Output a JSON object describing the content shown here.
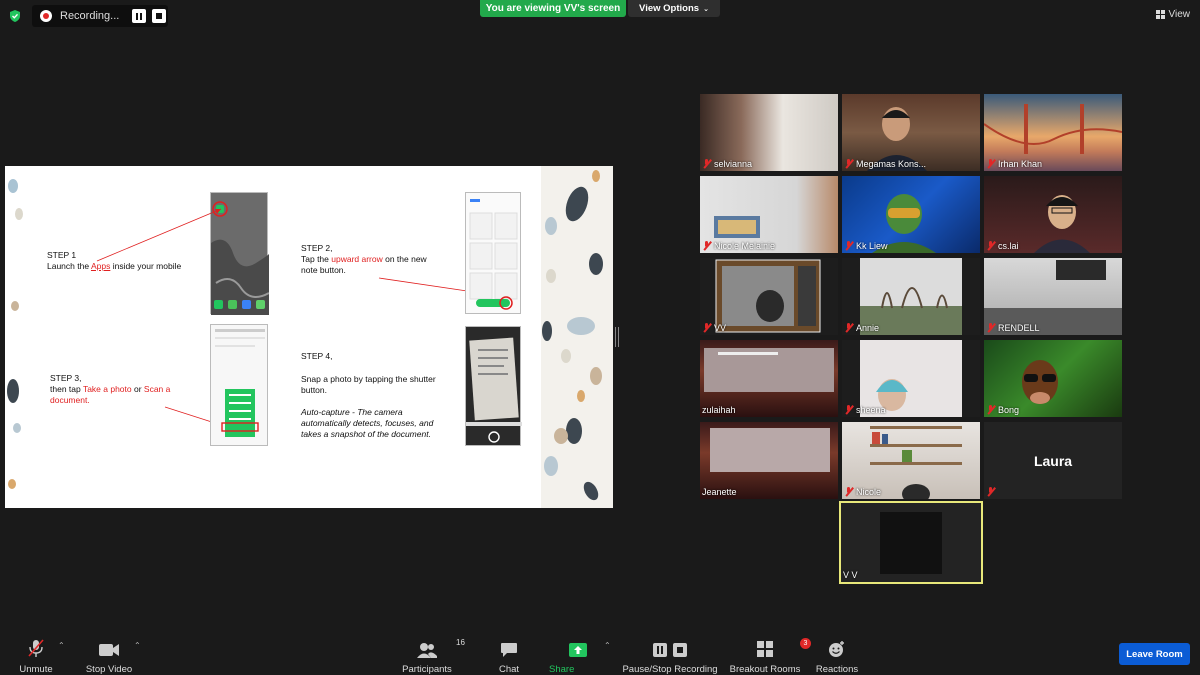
{
  "topbar": {
    "recording_label": "Recording...",
    "viewing_label": "You are viewing VV's screen",
    "view_options_label": "View Options",
    "view_label": "View"
  },
  "slide": {
    "step1_title": "STEP 1",
    "step1_pre": "Launch the ",
    "step1_link": "Apps",
    "step1_post": " inside your mobile",
    "step2_title": "STEP 2,",
    "step2_pre": "Tap the ",
    "step2_red": "upward arrow",
    "step2_post": " on the new",
    "step2_line2": "note button.",
    "step3_title": "STEP 3,",
    "step3_pre": "then tap ",
    "step3_red1": "Take a photo",
    "step3_mid": " or ",
    "step3_red2": "Scan a",
    "step3_red3": "document.",
    "step4_title": "STEP 4,",
    "step4_line1": "Snap a photo by tapping the shutter",
    "step4_line2": "button.",
    "step4_note1": "Auto-capture - The camera",
    "step4_note2": "automatically detects, focuses, and",
    "step4_note3": "takes a snapshot of the document."
  },
  "gallery": [
    {
      "name": "selvianna",
      "muted": true
    },
    {
      "name": "Megamas Kons...",
      "muted": true
    },
    {
      "name": "Irhan Khan",
      "muted": true
    },
    {
      "name": "Nicole Melainie",
      "muted": true
    },
    {
      "name": "Kk Liew",
      "muted": true
    },
    {
      "name": "cs.lai",
      "muted": true
    },
    {
      "name": "VV",
      "muted": true
    },
    {
      "name": "Annie",
      "muted": true
    },
    {
      "name": "RENDELL",
      "muted": true
    },
    {
      "name": "zulaihah",
      "muted": false
    },
    {
      "name": "sheena",
      "muted": true
    },
    {
      "name": "Bong",
      "muted": true
    },
    {
      "name": "Jeanette",
      "muted": false
    },
    {
      "name": "Nicole",
      "muted": true
    },
    {
      "name": "Laura",
      "muted": true
    },
    {
      "name": "V V",
      "muted": false
    }
  ],
  "toolbar": {
    "unmute": "Unmute",
    "stop_video": "Stop Video",
    "participants": "Participants",
    "participants_count": "16",
    "chat": "Chat",
    "share_screen": "Share Screen",
    "pause_stop_recording": "Pause/Stop Recording",
    "breakout_rooms": "Breakout Rooms",
    "breakout_badge": "3",
    "reactions": "Reactions",
    "leave_room": "Leave Room"
  },
  "colors": {
    "background": "#1a1a1a",
    "viewing_green": "#22a94b",
    "share_green": "#22c55e",
    "leave_blue": "#0b5cd5",
    "muted_red": "#e02828",
    "active_speaker": "#e8e87a"
  }
}
